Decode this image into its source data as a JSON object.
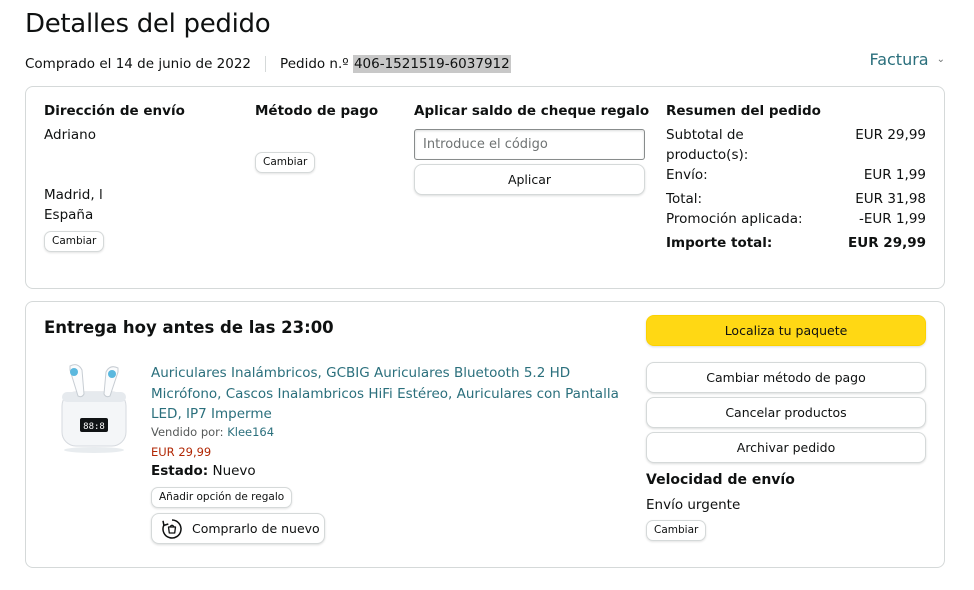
{
  "page": {
    "title": "Detalles del pedido",
    "purchase_date": "Comprado el 14 de junio de 2022",
    "order_prefix": "Pedido n.º",
    "order_number": "406-1521519-6037912",
    "invoice_label": "Factura"
  },
  "shipping": {
    "heading": "Dirección de envío",
    "name": "Adriano",
    "city": "Madrid, l",
    "country": "España",
    "change_label": "Cambiar"
  },
  "payment": {
    "heading": "Método de pago",
    "change_label": "Cambiar"
  },
  "gift": {
    "heading": "Aplicar saldo de cheque regalo",
    "placeholder": "Introduce el código",
    "apply_label": "Aplicar"
  },
  "summary": {
    "heading": "Resumen del pedido",
    "subtotal_label_1": "Subtotal de",
    "subtotal_label_2": "producto(s):",
    "subtotal_value": "EUR 29,99",
    "shipping_label": "Envío:",
    "shipping_value": "EUR 1,99",
    "total_label": "Total:",
    "total_value": "EUR 31,98",
    "promo_label": "Promoción aplicada:",
    "promo_value": "-EUR 1,99",
    "grand_label": "Importe total:",
    "grand_value": "EUR 29,99"
  },
  "delivery": {
    "title": "Entrega hoy antes de las 23:00",
    "product_title": "Auriculares Inalámbricos, GCBIG Auriculares Bluetooth 5.2 HD Micrófono, Cascos Inalambricos HiFi Estéreo, Auriculares con Pantalla LED, IP7 Imperme",
    "sold_by_label": "Vendido por:",
    "seller": "Klee164",
    "price": "EUR 29,99",
    "status_label": "Estado:",
    "status_value": "Nuevo",
    "gift_option_label": "Añadir opción de regalo",
    "buy_again_label": "Comprarlo de nuevo",
    "case_display": "88:8"
  },
  "actions": {
    "track_label": "Localiza tu paquete",
    "change_payment_label": "Cambiar método de pago",
    "cancel_label": "Cancelar productos",
    "archive_label": "Archivar pedido",
    "speed_heading": "Velocidad de envío",
    "speed_value": "Envío urgente",
    "speed_change_label": "Cambiar"
  },
  "colors": {
    "link": "#2a6f7c",
    "price": "#b12704",
    "primary_button": "#ffd814",
    "border": "#d5d9d9"
  },
  "icons": [
    "chevron-down-icon",
    "reorder-icon"
  ]
}
